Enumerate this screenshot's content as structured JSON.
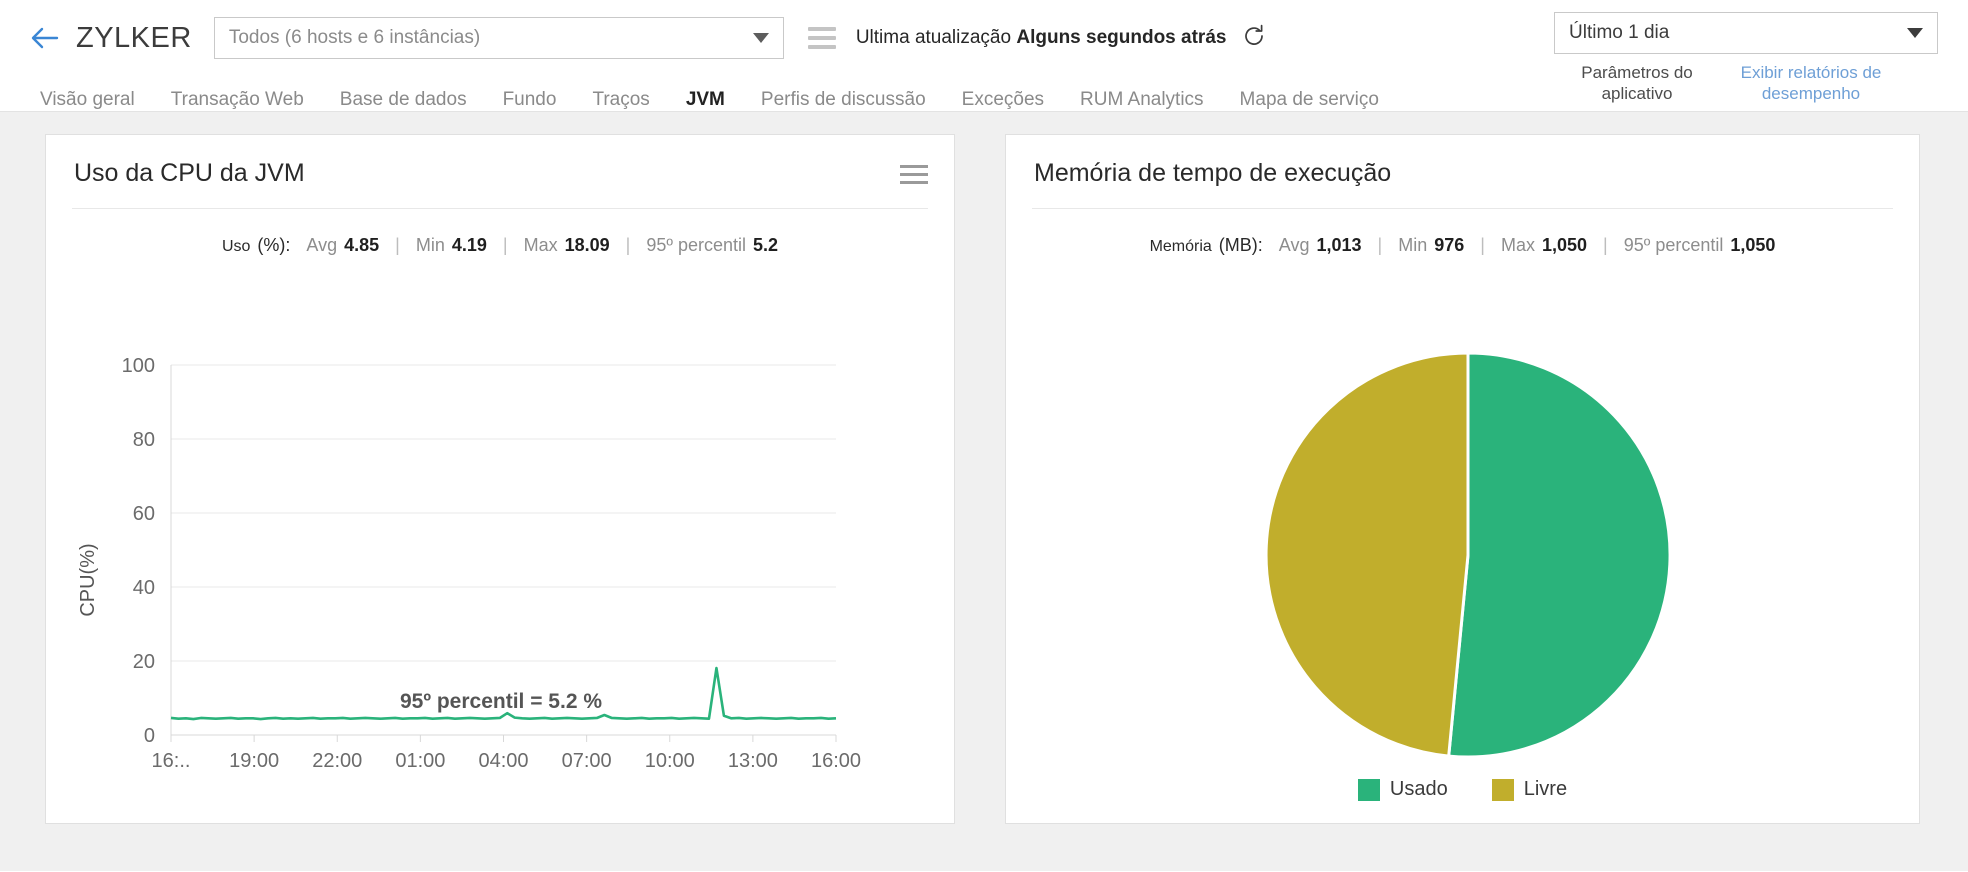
{
  "header": {
    "back_icon": "back-arrow-icon",
    "brand": "ZYLKER",
    "host_select_value": "Todos (6 hosts e 6 instâncias)",
    "hamburger_icon": "hamburger-icon",
    "update_prefix": "Ultima atualização",
    "update_value": "Alguns segundos atrás",
    "refresh_icon": "refresh-icon",
    "period_select_value": "Último 1 dia",
    "app_params_link": "Parâmetros do aplicativo",
    "perf_reports_link": "Exibir relatórios de desempenho"
  },
  "tabs": [
    {
      "label": "Visão geral",
      "active": false
    },
    {
      "label": "Transação Web",
      "active": false
    },
    {
      "label": "Base de dados",
      "active": false
    },
    {
      "label": "Fundo",
      "active": false
    },
    {
      "label": "Traços",
      "active": false
    },
    {
      "label": "JVM",
      "active": true
    },
    {
      "label": "Perfis de discussão",
      "active": false
    },
    {
      "label": "Exceções",
      "active": false
    },
    {
      "label": "RUM Analytics",
      "active": false
    },
    {
      "label": "Mapa de serviço",
      "active": false
    }
  ],
  "cpu_card": {
    "title": "Uso da CPU da JVM",
    "menu_icon": "hamburger-menu-icon",
    "stats": {
      "unit_label": "Uso",
      "unit_paren": "(%):",
      "avg_label": "Avg",
      "avg_value": "4.85",
      "min_label": "Min",
      "min_value": "4.19",
      "max_label": "Max",
      "max_value": "18.09",
      "p95_label": "95º percentil",
      "p95_value": "5.2",
      "separator": "|"
    },
    "annotation": "95º percentil = 5.2 %"
  },
  "mem_card": {
    "title": "Memória de tempo de execução",
    "stats": {
      "unit_label": "Memória",
      "unit_paren": "(MB):",
      "avg_label": "Avg",
      "avg_value": "1,013",
      "min_label": "Min",
      "min_value": "976",
      "max_label": "Max",
      "max_value": "1,050",
      "p95_label": "95º percentil",
      "p95_value": "1,050",
      "separator": "|"
    }
  },
  "colors": {
    "accent_blue": "#3a86d4",
    "link_blue": "#6e9fd6",
    "series_green": "#2ab37b",
    "series_olive": "#c1ae2c",
    "grid": "#eaeaea",
    "axis_text": "#6b6b6b"
  },
  "chart_data": [
    {
      "type": "line",
      "title": "Uso da CPU da JVM",
      "ylabel": "CPU(%)",
      "xlabel": "",
      "ylim": [
        0,
        100
      ],
      "yticks": [
        0,
        20,
        40,
        60,
        80,
        100
      ],
      "xticks": [
        "16:..",
        "19:00",
        "22:00",
        "01:00",
        "04:00",
        "07:00",
        "10:00",
        "13:00",
        "16:00"
      ],
      "grid": true,
      "legend": "none",
      "annotation": "95º percentil = 5.2 %",
      "series": [
        {
          "name": "Uso da CPU",
          "color": "#2ab37b",
          "values": [
            4.6,
            4.4,
            4.5,
            4.3,
            4.6,
            4.5,
            4.4,
            4.5,
            4.6,
            4.4,
            4.5,
            4.5,
            4.3,
            4.5,
            4.6,
            4.4,
            4.5,
            4.4,
            4.5,
            4.6,
            4.4,
            4.5,
            4.5,
            4.6,
            4.4,
            4.5,
            4.6,
            4.5,
            4.4,
            4.5,
            4.6,
            4.4,
            4.5,
            4.5,
            4.6,
            4.4,
            4.5,
            4.6,
            4.4,
            4.5,
            4.6,
            4.5,
            4.4,
            4.5,
            4.6,
            5.9,
            4.7,
            4.5,
            4.4,
            4.5,
            4.6,
            4.4,
            4.5,
            4.6,
            4.5,
            4.4,
            4.5,
            4.6,
            5.4,
            4.6,
            4.5,
            4.4,
            4.5,
            4.6,
            4.4,
            4.5,
            4.5,
            4.6,
            4.4,
            4.5,
            4.6,
            4.5,
            4.4,
            18.09,
            5.2,
            4.5,
            4.6,
            4.4,
            4.5,
            4.6,
            4.5,
            4.4,
            4.5,
            4.6,
            4.4,
            4.5,
            4.5,
            4.6,
            4.4,
            4.5
          ]
        }
      ],
      "stats": {
        "avg": 4.85,
        "min": 4.19,
        "max": 18.09,
        "p95": 5.2
      }
    },
    {
      "type": "pie",
      "title": "Memória de tempo de execução",
      "unit": "MB",
      "legend_position": "bottom",
      "labels": [
        "Usado",
        "Livre"
      ],
      "values": [
        541,
        509
      ],
      "colors": [
        "#2ab37b",
        "#c1ae2c"
      ],
      "stats": {
        "avg": 1013,
        "min": 976,
        "max": 1050,
        "p95": 1050
      }
    }
  ]
}
